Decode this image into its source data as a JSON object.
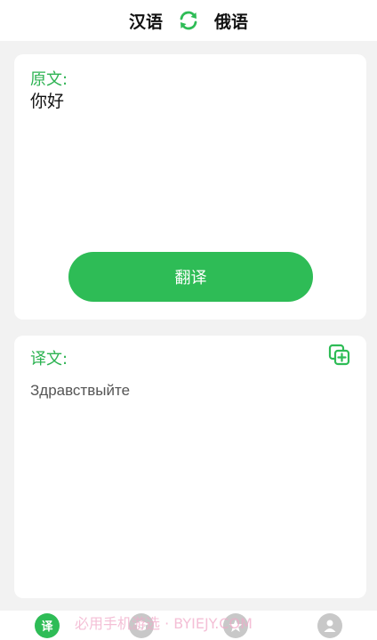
{
  "header": {
    "source_lang": "汉语",
    "target_lang": "俄语",
    "swap_icon": "swap-arrows-icon"
  },
  "source_card": {
    "label": "原文:",
    "text": "你好",
    "translate_button": "翻译"
  },
  "target_card": {
    "label": "译文:",
    "text": "Здравствыйте",
    "copy_icon": "copy-add-icon"
  },
  "bottom_nav": {
    "items": [
      {
        "name": "translate",
        "label": "译",
        "active": true
      },
      {
        "name": "learn",
        "icon": "graduation-cap-icon",
        "active": false
      },
      {
        "name": "favorites",
        "icon": "star-icon",
        "active": false
      },
      {
        "name": "profile",
        "icon": "user-icon",
        "active": false
      }
    ]
  },
  "watermark": "必用手机游选 · BYIEJY.COM",
  "colors": {
    "accent": "#2ebc56",
    "background": "#f2f2f2",
    "card": "#ffffff",
    "inactive_icon": "#c8c8c8"
  }
}
